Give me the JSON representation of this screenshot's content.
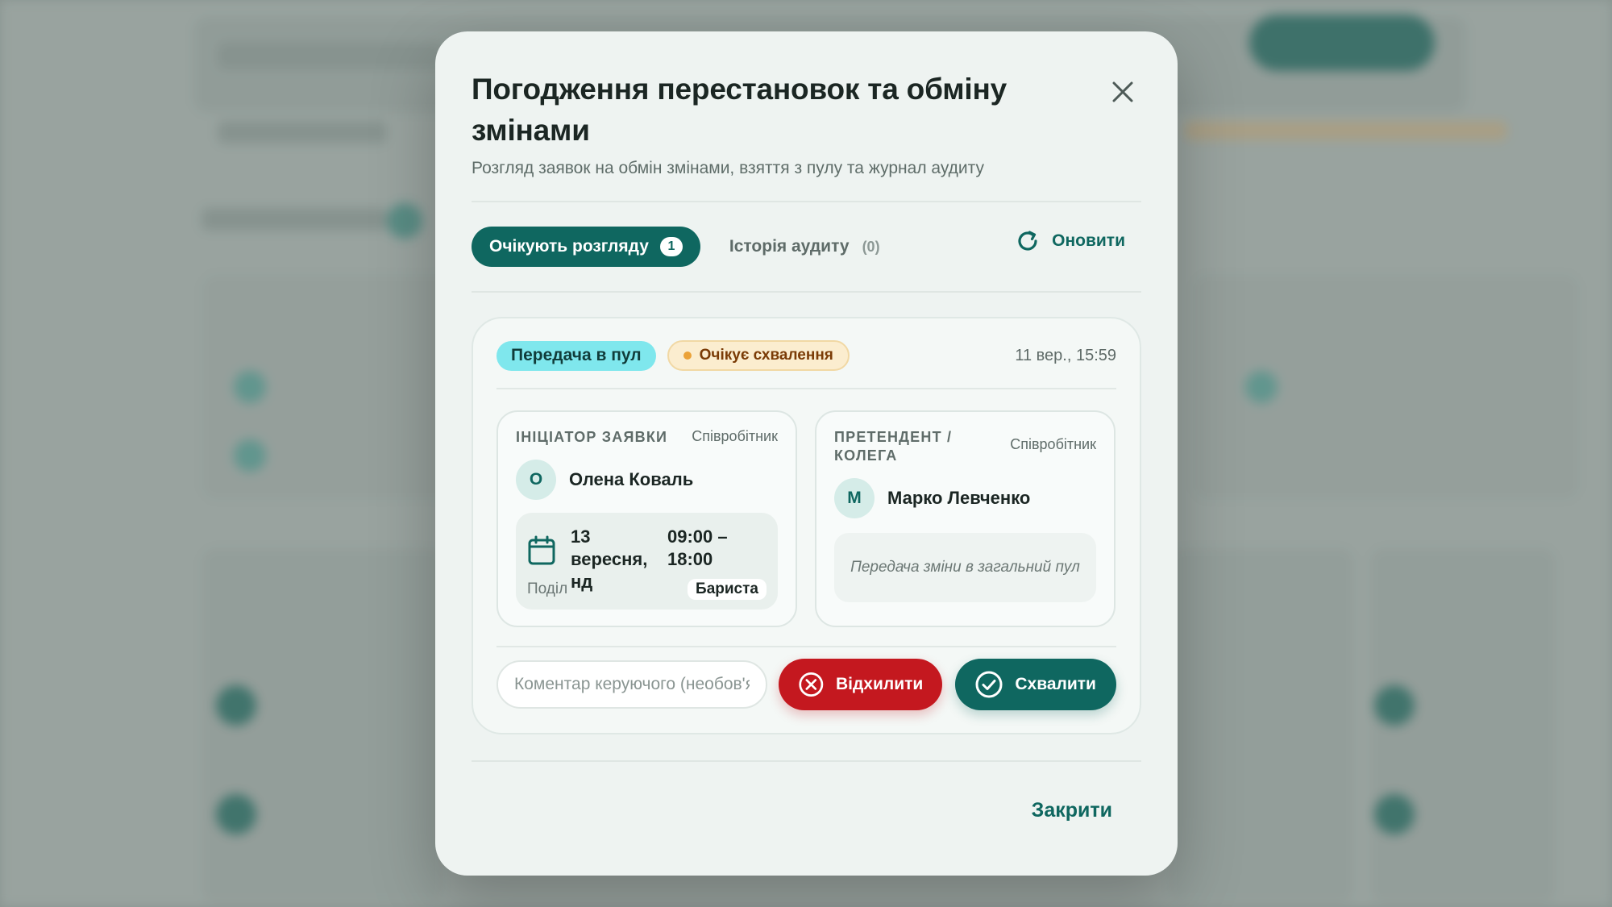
{
  "modal": {
    "title": "Погодження перестановок та обміну змінами",
    "subtitle": "Розгляд заявок на обмін змінами, взяття з пулу та журнал аудиту",
    "close_icon": "close-icon"
  },
  "tabs": {
    "pending_label": "Очікують розгляду",
    "pending_count": "1",
    "audit_label": "Історія аудиту",
    "audit_count": "(0)"
  },
  "refresh": {
    "label": "Оновити",
    "icon": "refresh-icon"
  },
  "request": {
    "type": "Передача в пул",
    "status": "Очікує схвалення",
    "timestamp": "11 вер., 15:59",
    "initiator": {
      "role": "ІНІЦІАТОР ЗАЯВКИ",
      "kind": "Співробітник",
      "avatar": "О",
      "name": "Олена Коваль",
      "shift_date": "13 вересня, нд",
      "shift_time": "09:00 – 18:00",
      "department_label": "Поділ",
      "position": "Бариста",
      "calendar_icon": "calendar-icon"
    },
    "candidate": {
      "role": "ПРЕТЕНДЕНТ / КОЛЕГА",
      "kind": "Співробітник",
      "avatar": "М",
      "name": "Марко Левченко",
      "note": "Передача зміни в загальний пул"
    }
  },
  "actions": {
    "comment_placeholder": "Коментар керуючого (необов'язково)",
    "comment_value": "",
    "reject_label": "Відхилити",
    "approve_label": "Схвалити"
  },
  "footer": {
    "close_label": "Закрити"
  },
  "colors": {
    "primary": "#0f6760",
    "danger": "#c4181f",
    "type_badge": "#7fe7ed",
    "status_badge": "#fbedcf",
    "status_dot": "#eba238"
  }
}
